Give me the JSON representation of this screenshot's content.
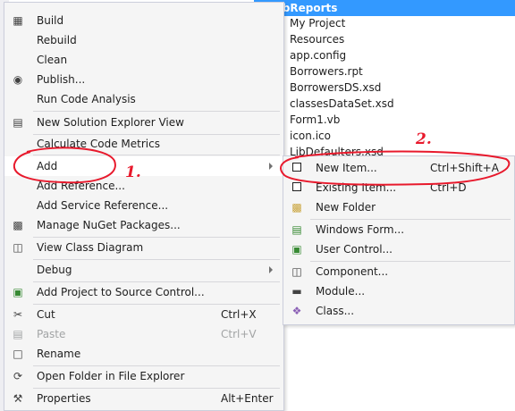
{
  "solution_explorer": {
    "project_name": "LibReports",
    "items": [
      "My Project",
      "Resources",
      "app.config",
      "Borrowers.rpt",
      "BorrowersDS.xsd",
      "classesDataSet.xsd",
      "Form1.vb",
      "icon.ico",
      "LibDefaulters.xsd"
    ]
  },
  "context_menu": {
    "build": "Build",
    "rebuild": "Rebuild",
    "clean": "Clean",
    "publish": "Publish...",
    "run_code_analysis": "Run Code Analysis",
    "new_solution_explorer_view": "New Solution Explorer View",
    "calculate_code_metrics": "Calculate Code Metrics",
    "add": "Add",
    "add_reference": "Add Reference...",
    "add_service_reference": "Add Service Reference...",
    "manage_nuget": "Manage NuGet Packages...",
    "view_class_diagram": "View Class Diagram",
    "debug": "Debug",
    "add_to_source_control": "Add Project to Source Control...",
    "cut": "Cut",
    "cut_shortcut": "Ctrl+X",
    "paste": "Paste",
    "paste_shortcut": "Ctrl+V",
    "rename": "Rename",
    "open_folder": "Open Folder in File Explorer",
    "properties": "Properties",
    "properties_shortcut": "Alt+Enter"
  },
  "add_submenu": {
    "new_item": "New Item...",
    "new_item_shortcut": "Ctrl+Shift+A",
    "existing_item": "Existing Item...",
    "existing_item_shortcut": "Ctrl+D",
    "new_folder": "New Folder",
    "windows_form": "Windows Form...",
    "user_control": "User Control...",
    "component": "Component...",
    "module": "Module...",
    "class": "Class..."
  },
  "annotations": {
    "step1": "1.",
    "step2": "2.",
    "color": "#e8192c"
  }
}
